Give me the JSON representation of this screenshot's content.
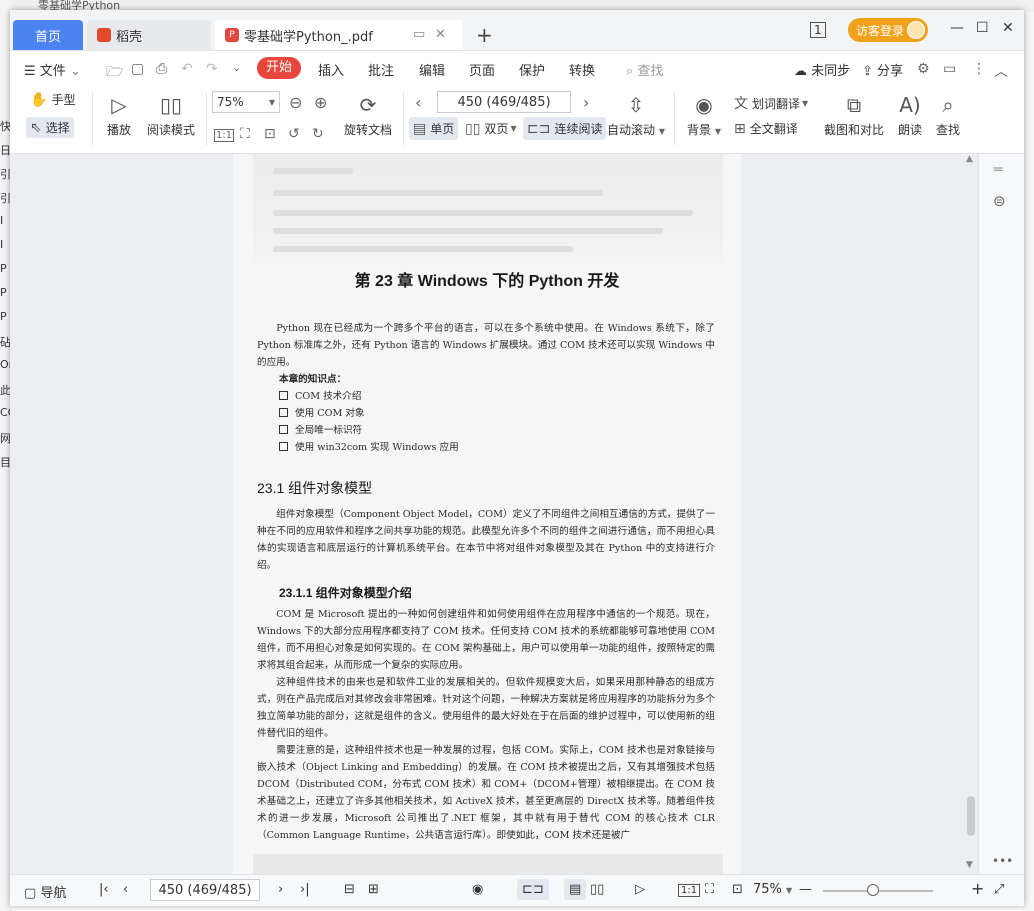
{
  "background": {
    "top_title": "零基础学Python",
    "left_letters": [
      "快",
      "日",
      "引",
      "引",
      "I",
      "I",
      "P",
      "P",
      "P",
      "砧",
      "Or",
      "此",
      "CO",
      "网",
      "目"
    ]
  },
  "titlebar": {
    "tabs": [
      {
        "label": "首页",
        "active": false
      },
      {
        "label": "稻壳",
        "icon": "docer-icon"
      },
      {
        "label": "零基础学Python_.pdf",
        "icon": "pdf-icon"
      }
    ],
    "new_tab": "+",
    "login_label": "访客登录",
    "window_controls": [
      "—",
      "☐",
      "✕"
    ]
  },
  "menubar": {
    "file_label": "文件",
    "items": [
      "开始",
      "插入",
      "批注",
      "编辑",
      "页面",
      "保护",
      "转换"
    ],
    "search_label": "查找",
    "sync_label": "未同步",
    "share_label": "分享"
  },
  "ribbon": {
    "hand_label": "手型",
    "select_label": "选择",
    "play_label": "播放",
    "read_mode_label": "阅读模式",
    "zoom_value": "75%",
    "rotate_label": "旋转文档",
    "page_value": "450 (469/485)",
    "single_label": "单页",
    "double_label": "双页",
    "continuous_label": "连续阅读",
    "autoscroll_label": "自动滚动",
    "background_label": "背景",
    "word_translate_label": "划词翻译",
    "full_translate_label": "全文翻译",
    "screenshot_compare_label": "截图和对比",
    "read_aloud_label": "朗读",
    "find_label": "查找"
  },
  "document": {
    "chapter_title": "第 23 章   Windows 下的 Python 开发",
    "intro": "Python 现在已经成为一个跨多个平台的语言，可以在多个系统中使用。在 Windows 系统下，除了 Python 标准库之外，还有 Python 语言的 Windows 扩展模块。通过 COM 技术还可以实现 Windows 中的应用。",
    "knowledge_title": "本章的知识点：",
    "knowledge_points": [
      "COM 技术介绍",
      "使用 COM 对象",
      "全局唯一标识符",
      "使用 win32com 实现 Windows 应用"
    ],
    "section_title": "23.1   组件对象模型",
    "section_para": "组件对象模型（Component Object Model，COM）定义了不同组件之间相互通信的方式，提供了一种在不同的应用软件和程序之间共享功能的规范。此模型允许多个不同的组件之间进行通信，而不用担心具体的实现语言和底层运行的计算机系统平台。在本节中将对组件对象模型及其在 Python 中的支持进行介绍。",
    "subsection_title": "23.1.1   组件对象模型介绍",
    "paras": [
      "COM 是 Microsoft 提出的一种如何创建组件和如何使用组件在应用程序中通信的一个规范。现在，Windows 下的大部分应用程序都支持了 COM 技术。任何支持 COM 技术的系统都能够可靠地使用 COM 组件，而不用担心对象是如何实现的。在 COM 架构基础上，用户可以使用单一功能的组件，按照特定的需求将其组合起来，从而形成一个复杂的实际应用。",
      "这种组件技术的由来也是和软件工业的发展相关的。但软件规模变大后，如果采用那种静态的组成方式，则在产品完成后对其修改会非常困难。针对这个问题，一种解决方案就是将应用程序的功能拆分为多个独立简单功能的部分，这就是组件的含义。使用组件的最大好处在于在后面的维护过程中，可以使用新的组件替代旧的组件。",
      "需要注意的是，这种组件技术也是一种发展的过程，包括 COM。实际上，COM 技术也是对象链接与嵌入技术（Object Linking and Embedding）的发展。在 COM 技术被提出之后，又有其增强技术包括 DCOM（Distributed COM，分布式 COM 技术）和 COM+（DCOM+管理）被相继提出。在 COM 技术基础之上，还建立了许多其他相关技术，如 ActiveX 技术，甚至更高层的 DirectX 技术等。随着组件技术的进一步发展，Microsoft 公司推出了.NET 框架，其中就有用于替代 COM 的核心技术 CLR（Common Language Runtime，公共语言运行库）。即使如此，COM 技术还是被广"
    ]
  },
  "statusbar": {
    "nav_label": "导航",
    "page_value": "450 (469/485)",
    "zoom_value": "75%",
    "zoom_fraction": 0.45
  },
  "colors": {
    "accent": "#4b84f0",
    "start_red": "#e8463a",
    "login_orange": "#f0a21a"
  }
}
